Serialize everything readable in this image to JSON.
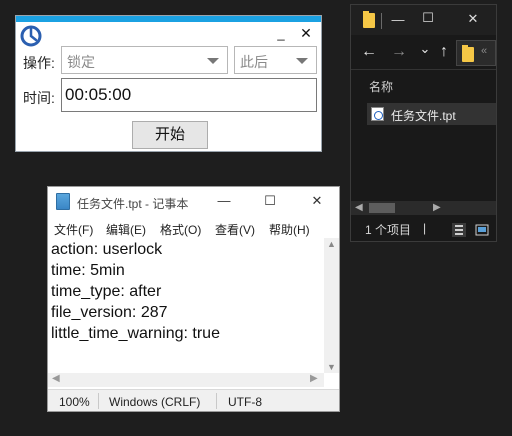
{
  "timer_app": {
    "controls": {
      "minimize": "_",
      "close": "✕"
    },
    "operation_label": "操作:",
    "operation_value": "锁定",
    "timing_value": "此后",
    "time_label": "时间:",
    "time_value": "00:05:00",
    "start_button": "开始",
    "accent_color": "#1ba1e2"
  },
  "explorer": {
    "window_controls": {
      "minimize": "—",
      "maximize": "☐",
      "close": "✕"
    },
    "nav": {
      "back": "←",
      "forward": "→",
      "recent": "⌄",
      "up": "↑",
      "path_more": "«"
    },
    "column_header": "名称",
    "file_name": "任务文件.tpt",
    "status_text": "1 个项目",
    "status_sep": "|"
  },
  "notepad": {
    "title": "任务文件.tpt - 记事本",
    "window_controls": {
      "minimize": "—",
      "maximize": "☐",
      "close": "✕"
    },
    "menu": [
      "文件(F)",
      "编辑(E)",
      "格式(O)",
      "查看(V)",
      "帮助(H)"
    ],
    "content_lines": [
      "action: userlock",
      "time: 5min",
      "time_type: after",
      "file_version: 287",
      "little_time_warning: true"
    ],
    "status": {
      "zoom": "100%",
      "line_ending": "Windows (CRLF)",
      "encoding": "UTF-8"
    }
  }
}
